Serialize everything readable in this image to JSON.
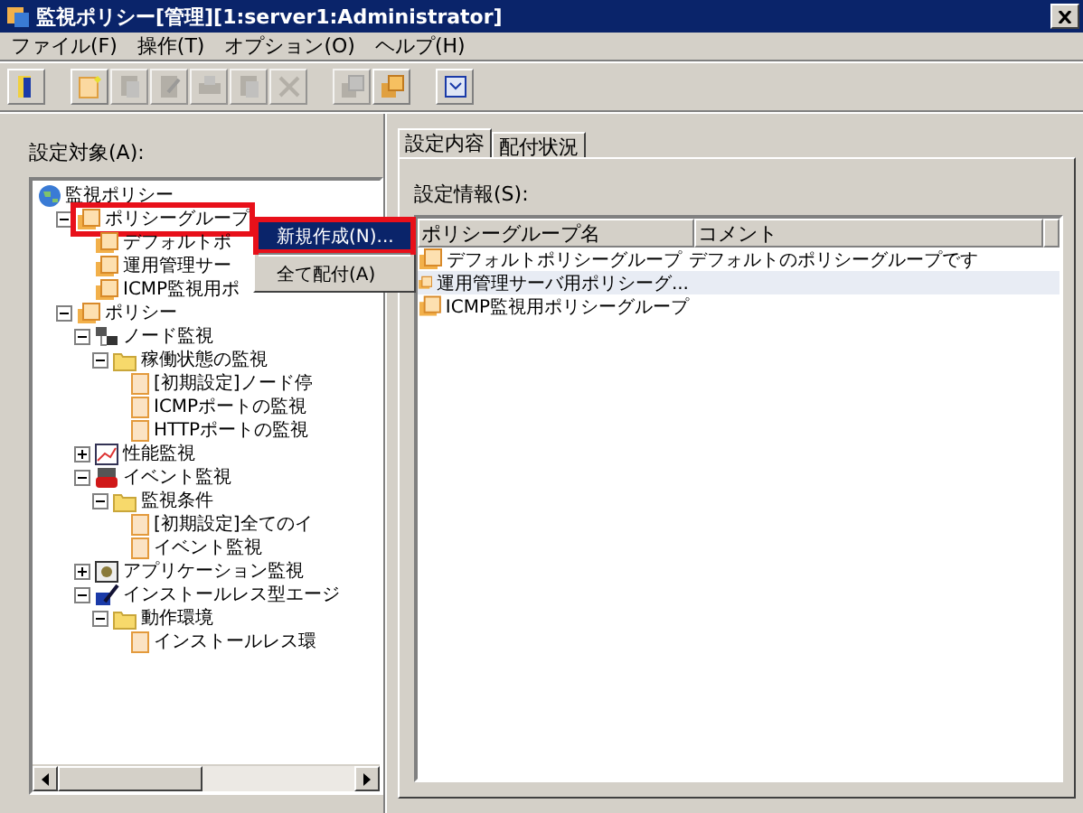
{
  "window": {
    "title": "監視ポリシー[管理][1:server1:Administrator]"
  },
  "menu": [
    "ファイル(F)",
    "操作(T)",
    "オプション(O)",
    "ヘルプ(H)"
  ],
  "toolbar": [
    [
      {
        "kind": "exit",
        "disabled": false
      }
    ],
    [
      {
        "kind": "new",
        "disabled": false
      },
      {
        "kind": "copy",
        "disabled": true
      },
      {
        "kind": "edit",
        "disabled": true
      },
      {
        "kind": "print",
        "disabled": true
      },
      {
        "kind": "copy",
        "disabled": true
      },
      {
        "kind": "delete",
        "disabled": true
      }
    ],
    [
      {
        "kind": "stack",
        "disabled": true
      },
      {
        "kind": "stack",
        "disabled": false
      }
    ],
    [
      {
        "kind": "window",
        "disabled": false
      }
    ]
  ],
  "tree_label": "設定対象(A):",
  "tree": [
    {
      "label": "監視ポリシー",
      "kind": "globe",
      "annotated": false,
      "children": [
        {
          "label": "ポリシーグループ",
          "kind": "group",
          "expanded": true,
          "annotated": true,
          "children": [
            {
              "label": "デフォルトポ",
              "kind": "group",
              "annotated": false
            },
            {
              "label": "運用管理サー",
              "kind": "group",
              "annotated": false
            },
            {
              "label": "ICMP監視用ポ",
              "kind": "group",
              "annotated": false
            }
          ]
        },
        {
          "label": "ポリシー",
          "kind": "group",
          "expanded": true,
          "annotated": false,
          "children": [
            {
              "label": "ノード監視",
              "kind": "node",
              "expanded": true,
              "annotated": false,
              "children": [
                {
                  "label": "稼働状態の監視",
                  "kind": "folder",
                  "expanded": true,
                  "annotated": false,
                  "children": [
                    {
                      "label": "[初期設定]ノード停",
                      "kind": "doc",
                      "annotated": false
                    },
                    {
                      "label": "ICMPポートの監視",
                      "kind": "doc",
                      "annotated": false
                    },
                    {
                      "label": "HTTPポートの監視",
                      "kind": "doc",
                      "annotated": false
                    }
                  ]
                }
              ]
            },
            {
              "label": "性能監視",
              "kind": "chart",
              "expanded": false,
              "annotated": false
            },
            {
              "label": "イベント監視",
              "kind": "event",
              "expanded": true,
              "annotated": false,
              "children": [
                {
                  "label": "監視条件",
                  "kind": "folder",
                  "expanded": true,
                  "annotated": false,
                  "children": [
                    {
                      "label": "[初期設定]全てのイ",
                      "kind": "doc",
                      "annotated": false
                    },
                    {
                      "label": "イベント監視",
                      "kind": "doc",
                      "annotated": false
                    }
                  ]
                }
              ]
            },
            {
              "label": "アプリケーション監視",
              "kind": "app",
              "expanded": false,
              "annotated": false
            },
            {
              "label": "インストールレス型エージ",
              "kind": "agent",
              "expanded": true,
              "annotated": false,
              "children": [
                {
                  "label": "動作環境",
                  "kind": "folder",
                  "expanded": true,
                  "annotated": false,
                  "children": [
                    {
                      "label": "インストールレス環",
                      "kind": "doc",
                      "annotated": false
                    }
                  ]
                }
              ]
            }
          ]
        }
      ]
    }
  ],
  "context_menu": [
    {
      "label": "新規作成(N)...",
      "selected": true,
      "annotated": true
    },
    {
      "label": "全て配付(A)",
      "selected": false,
      "annotated": false
    }
  ],
  "tabs": [
    {
      "label": "設定内容",
      "selected": true
    },
    {
      "label": "配付状況",
      "selected": false
    }
  ],
  "settings_label": "設定情報(S):",
  "table": {
    "columns": [
      "ポリシーグループ名",
      "コメント"
    ],
    "rows": [
      {
        "name": "デフォルトポリシーグループ",
        "comment": "デフォルトのポリシーグループです",
        "selected": false
      },
      {
        "name": "運用管理サーバ用ポリシーグ...",
        "selected": true
      },
      {
        "name": "ICMP監視用ポリシーグループ",
        "selected": false
      }
    ]
  }
}
